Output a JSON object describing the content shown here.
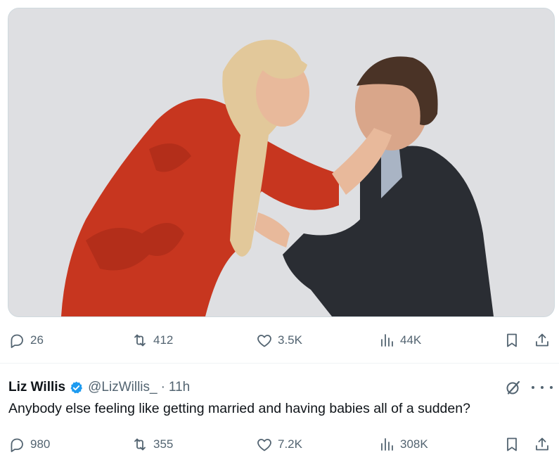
{
  "top_tweet": {
    "media": {
      "icon": "photo-couple-proposal"
    },
    "actions": {
      "replies": "26",
      "retweets": "412",
      "likes": "3.5K",
      "views": "44K"
    }
  },
  "reply_tweet": {
    "author_name": "Liz Willis",
    "handle": "@LizWillis_",
    "separator": "·",
    "time": "11h",
    "text": "Anybody else feeling like getting married and having babies all of a sudden?",
    "actions": {
      "replies": "980",
      "retweets": "355",
      "likes": "7.2K",
      "views": "308K"
    }
  },
  "colors": {
    "text_primary": "#0f1419",
    "text_secondary": "#536471",
    "verified_blue": "#1d9bf0",
    "divider": "#eff3f4"
  }
}
